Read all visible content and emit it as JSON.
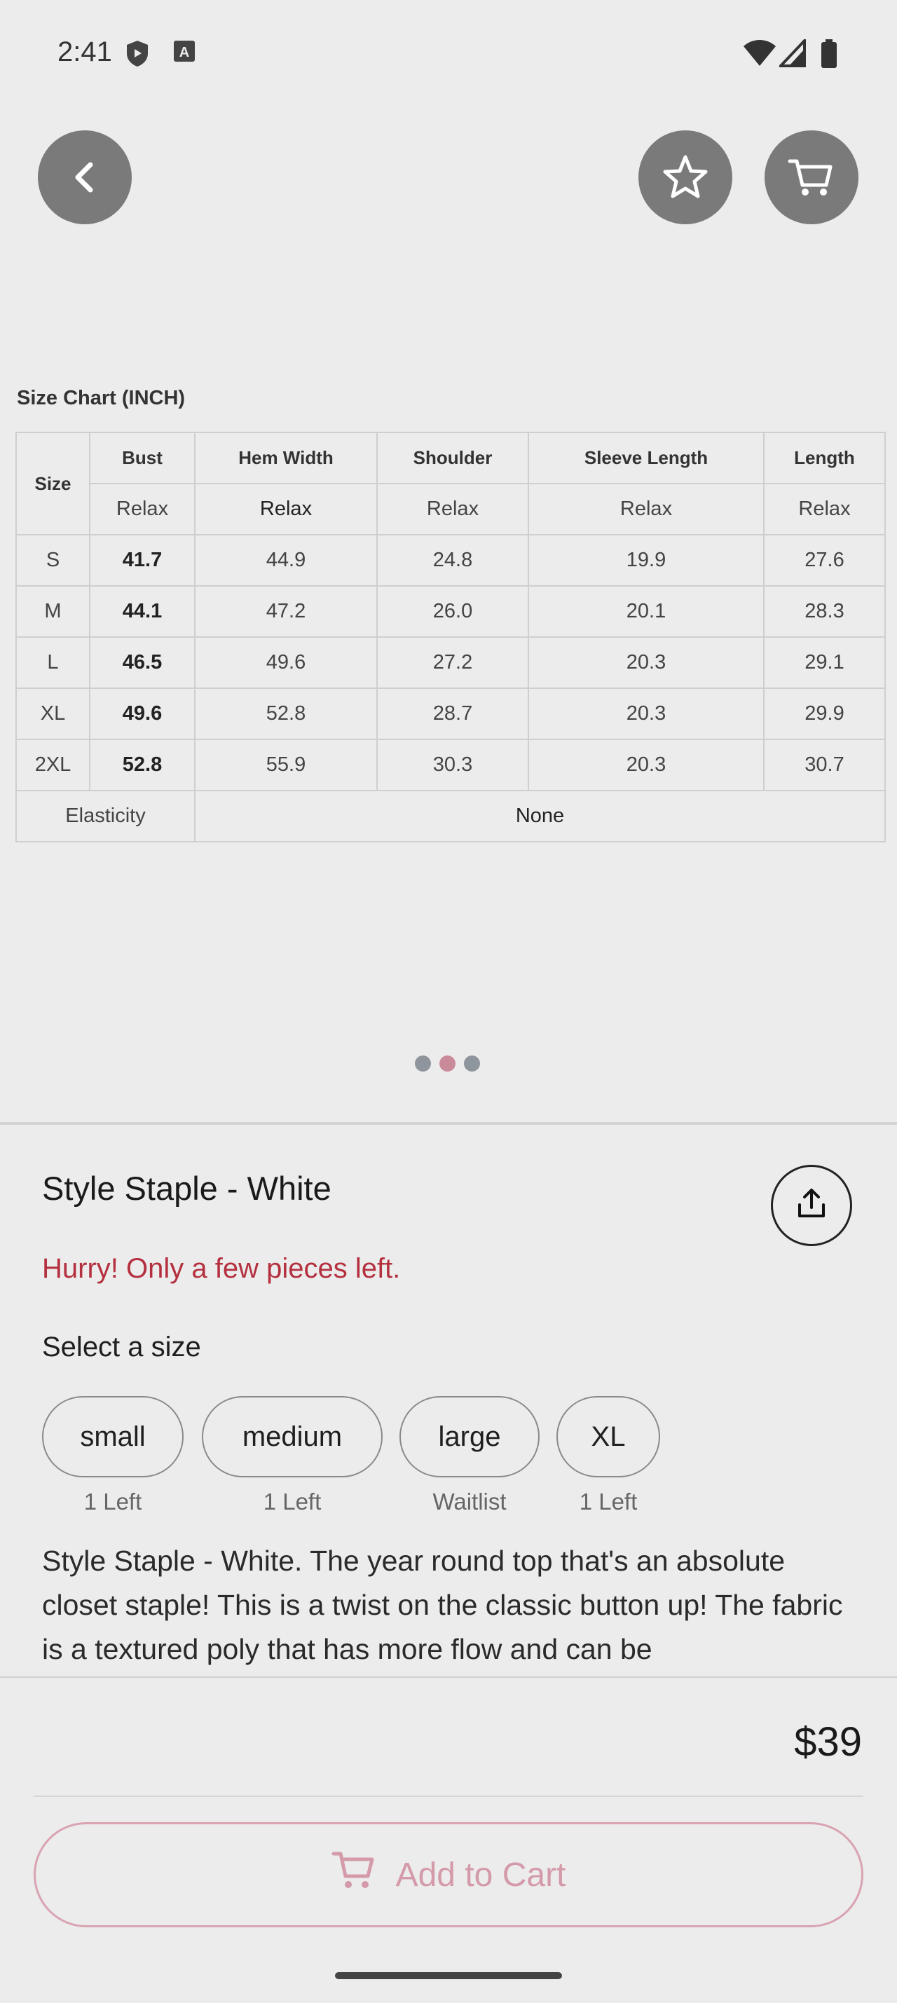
{
  "status_bar": {
    "time": "2:41",
    "icons": [
      "shield-icon",
      "keyboard-a-icon",
      "wifi-icon",
      "signal-icon",
      "battery-icon"
    ]
  },
  "top_bar": {
    "back": "chevron-left-icon",
    "favorite": "star-icon",
    "cart": "cart-icon"
  },
  "size_chart": {
    "title": "Size Chart (INCH)",
    "header": [
      "Size",
      "Bust",
      "Hem Width",
      "Shoulder",
      "Sleeve Length",
      "Length"
    ],
    "subheader": [
      "Relax",
      "Relax",
      "Relax",
      "Relax",
      "Relax"
    ],
    "rows": [
      [
        "S",
        "41.7",
        "44.9",
        "24.8",
        "19.9",
        "27.6"
      ],
      [
        "M",
        "44.1",
        "47.2",
        "26.0",
        "20.1",
        "28.3"
      ],
      [
        "L",
        "46.5",
        "49.6",
        "27.2",
        "20.3",
        "29.1"
      ],
      [
        "XL",
        "49.6",
        "52.8",
        "28.7",
        "20.3",
        "29.9"
      ],
      [
        "2XL",
        "52.8",
        "55.9",
        "30.3",
        "20.3",
        "30.7"
      ]
    ],
    "elasticity_label": "Elasticity",
    "elasticity_value": "None"
  },
  "pager": {
    "count": 3,
    "active_index": 1
  },
  "product": {
    "title": "Style Staple - White",
    "share": "share-icon",
    "stock_warning": "Hurry! Only a few pieces left.",
    "select_size_label": "Select a size",
    "sizes": [
      {
        "label": "small",
        "note": "1 Left"
      },
      {
        "label": "medium",
        "note": "1 Left"
      },
      {
        "label": "large",
        "note": "Waitlist"
      },
      {
        "label": "XL",
        "note": "1 Left"
      }
    ],
    "description": "Style Staple - White. The year round top that's an absolute closet staple! This is a twist on the classic button up! The fabric is a textured poly that has more flow and can be"
  },
  "purchase": {
    "price": "$39",
    "add_to_cart": "Add to Cart"
  },
  "colors": {
    "accent_pink": "#d49aa9",
    "warning_red": "#b4303f",
    "button_grey": "#7a7a7a"
  }
}
